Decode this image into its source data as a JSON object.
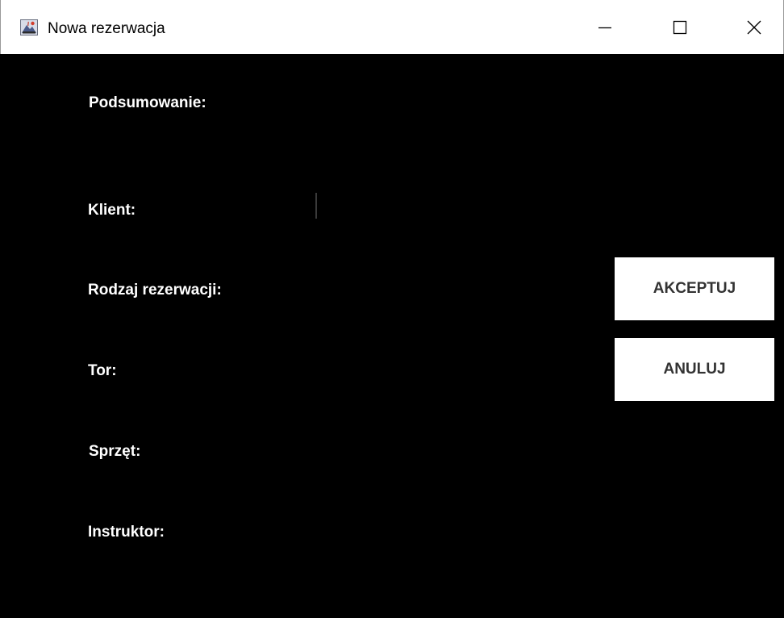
{
  "window": {
    "title": "Nowa rezerwacja",
    "icons": {
      "app": "java-app-icon",
      "minimize": "minimize-icon",
      "maximize": "maximize-icon",
      "close": "close-icon"
    }
  },
  "summary": {
    "heading": "Podsumowanie:",
    "labels": {
      "client": "Klient:",
      "reservation_type": "Rodzaj rezerwacji:",
      "lane": "Tor:",
      "equipment": "Sprzęt:",
      "instructor": "Instruktor:"
    },
    "values": {
      "client": "",
      "reservation_type": "",
      "lane": "",
      "equipment": "",
      "instructor": ""
    }
  },
  "actions": {
    "accept_label": "AKCEPTUJ",
    "cancel_label": "ANULUJ"
  },
  "colors": {
    "background": "#000000",
    "titlebar": "#ffffff",
    "label_text": "#ffffff",
    "button_bg": "#ffffff",
    "button_text": "#333333"
  }
}
